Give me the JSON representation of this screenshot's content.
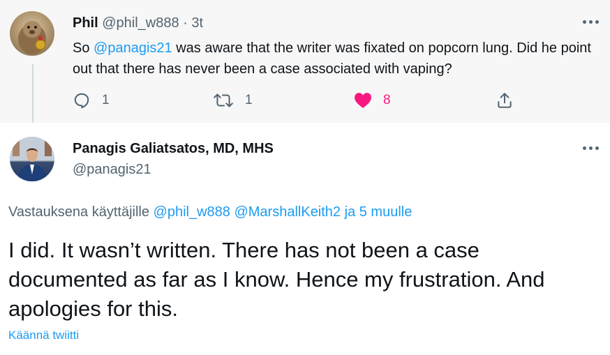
{
  "reply_tweet": {
    "display_name": "Phil",
    "handle": "@phil_w888",
    "separator": "·",
    "time": "3t",
    "text_before": "So ",
    "mention": "@panagis21",
    "text_after": " was aware that the writer was fixated on popcorn lung. Did he point out that there has never been a case associated with vaping?",
    "reply_count": "1",
    "retweet_count": "1",
    "like_count": "8",
    "liked": true,
    "like_color": "#f91880",
    "icons": [
      "reply-icon",
      "retweet-icon",
      "heart-icon",
      "share-icon",
      "more-icon"
    ]
  },
  "main_tweet": {
    "display_name": "Panagis Galiatsatos, MD, MHS",
    "handle": "@panagis21",
    "replying_prefix": "Vastauksena käyttäjille",
    "replying_mentions": [
      "@phil_w888",
      "@MarshallKeith2"
    ],
    "replying_suffix": "ja 5 muulle",
    "text": "I did. It wasn’t written. There has not been a case documented as far as I know. Hence my frustration. And apologies for this.",
    "translate_label": "Käännä twiitti"
  },
  "colors": {
    "accent": "#1d9bf0",
    "secondary_text": "#536471",
    "reply_background": "#f7f7f7"
  }
}
